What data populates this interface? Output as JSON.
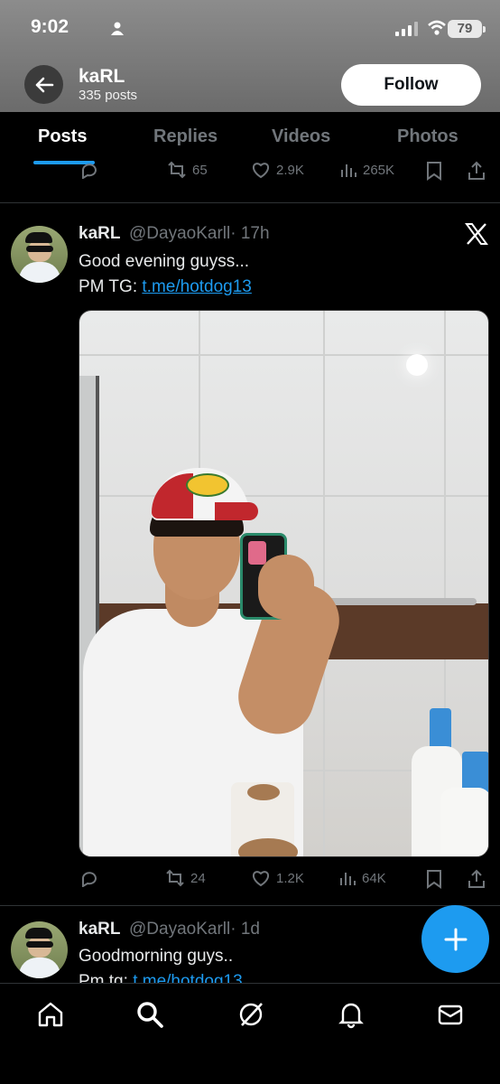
{
  "status_bar": {
    "time": "9:02",
    "battery": "79"
  },
  "header": {
    "name": "kaRL",
    "post_count": "335 posts",
    "follow_label": "Follow"
  },
  "tabs": [
    {
      "label": "Posts",
      "active": true
    },
    {
      "label": "Replies",
      "active": false
    },
    {
      "label": "Videos",
      "active": false
    },
    {
      "label": "Photos",
      "active": false
    }
  ],
  "prev_post_actions": {
    "reposts": "65",
    "likes": "2.9K",
    "views": "265K"
  },
  "posts": [
    {
      "name": "kaRL",
      "handle": "@DayaoKarll",
      "time": "· 17h",
      "line1": "Good evening guyss...",
      "line2_prefix": "PM TG: ",
      "line2_link": "t.me/hotdog13",
      "actions": {
        "reposts": "24",
        "likes": "1.2K",
        "views": "64K"
      }
    },
    {
      "name": "kaRL",
      "handle": "@DayaoKarll",
      "time": "· 1d",
      "line1": "Goodmorning guys..",
      "line2_prefix": "Pm tg: ",
      "line2_link": "t.me/hotdog13"
    }
  ],
  "icons": {
    "accent": "#1d9bf0",
    "muted": "#71767b"
  }
}
